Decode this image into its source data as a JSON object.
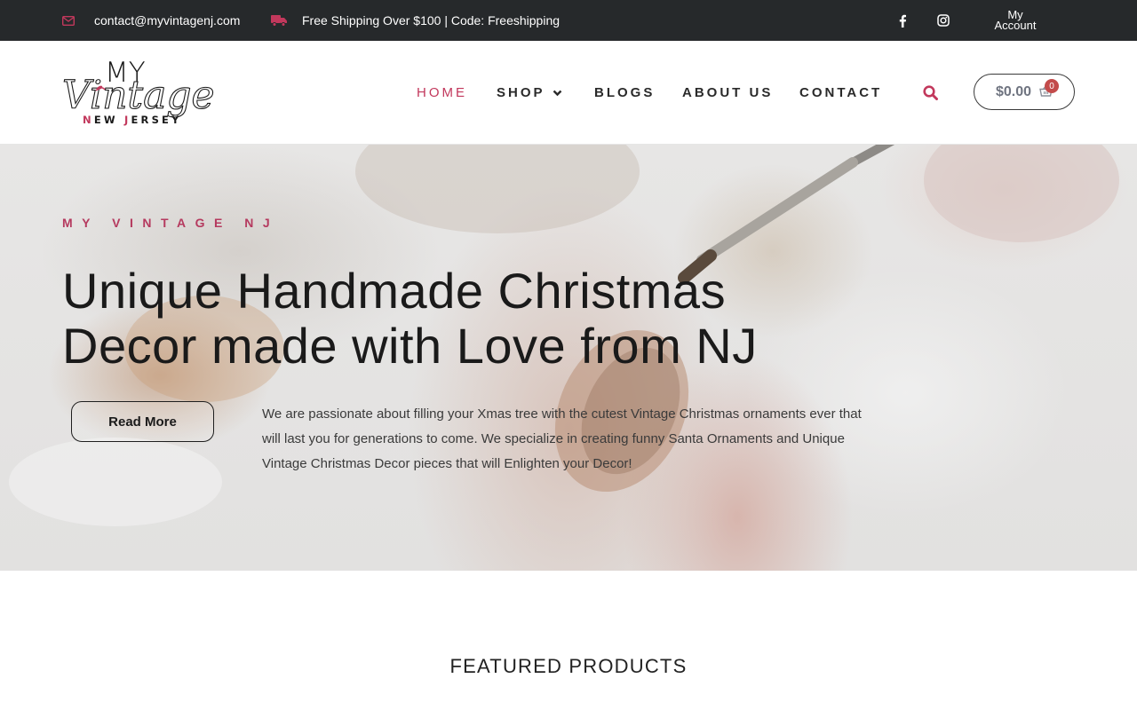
{
  "topbar": {
    "email": "contact@myvintagenj.com",
    "shipping": "Free Shipping Over $100 | Code: Freeshipping",
    "account_line1": "My",
    "account_line2": "Account",
    "icons": [
      "envelope-icon",
      "truck-icon",
      "facebook-icon",
      "instagram-icon"
    ]
  },
  "logo": {
    "line1": "MY",
    "line2": "Vintage",
    "line3_a": "N",
    "line3_b": "EW ",
    "line3_c": "J",
    "line3_d": "ERSEY"
  },
  "nav": {
    "items": [
      {
        "label": "HOME",
        "active": true
      },
      {
        "label": "SHOP",
        "has_dropdown": true
      },
      {
        "label": "BLOGS"
      },
      {
        "label": "ABOUT US"
      },
      {
        "label": "CONTACT"
      }
    ]
  },
  "cart": {
    "total": "$0.00",
    "count": "0"
  },
  "hero": {
    "kicker": "MY VINTAGE NJ",
    "title_line1": "Unique Handmade Christmas",
    "title_line2": "Decor made with Love from NJ",
    "button_label": "Read More",
    "body": "We are passionate about filling your Xmas tree with the cutest Vintage Christmas ornaments ever that will last you for generations to come. We specialize in creating funny Santa Ornaments and Unique Vintage Christmas Decor pieces that will Enlighten your Decor!"
  },
  "featured": {
    "title": "FEATURED PRODUCTS"
  },
  "colors": {
    "accent": "#c2385c",
    "topbar_bg": "#26292b",
    "cart_badge": "#c34b4b"
  }
}
